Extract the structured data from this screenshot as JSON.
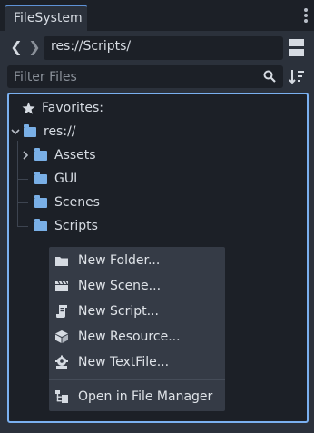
{
  "dock": {
    "tab_label": "FileSystem"
  },
  "nav": {
    "back_glyph": "❮",
    "forward_glyph": "❯",
    "path_value": "res://Scripts/"
  },
  "filter": {
    "placeholder": "Filter Files",
    "value": ""
  },
  "tree": {
    "favorites_label": "Favorites:",
    "root_label": "res://",
    "folders": [
      {
        "label": "Assets",
        "expandable": true
      },
      {
        "label": "GUI",
        "expandable": false
      },
      {
        "label": "Scenes",
        "expandable": false
      },
      {
        "label": "Scripts",
        "expandable": false
      }
    ]
  },
  "context_menu": {
    "items": [
      {
        "label": "New Folder...",
        "icon": "folder-icon"
      },
      {
        "label": "New Scene...",
        "icon": "clapperboard-icon"
      },
      {
        "label": "New Script...",
        "icon": "script-icon"
      },
      {
        "label": "New Resource...",
        "icon": "cube-icon"
      },
      {
        "label": "New TextFile...",
        "icon": "gear-text-icon"
      }
    ],
    "open_in_manager_label": "Open in File Manager"
  },
  "colors": {
    "accent": "#7ab0f0",
    "folder": "#79afe6",
    "tab_highlight": "#5e92d6"
  }
}
